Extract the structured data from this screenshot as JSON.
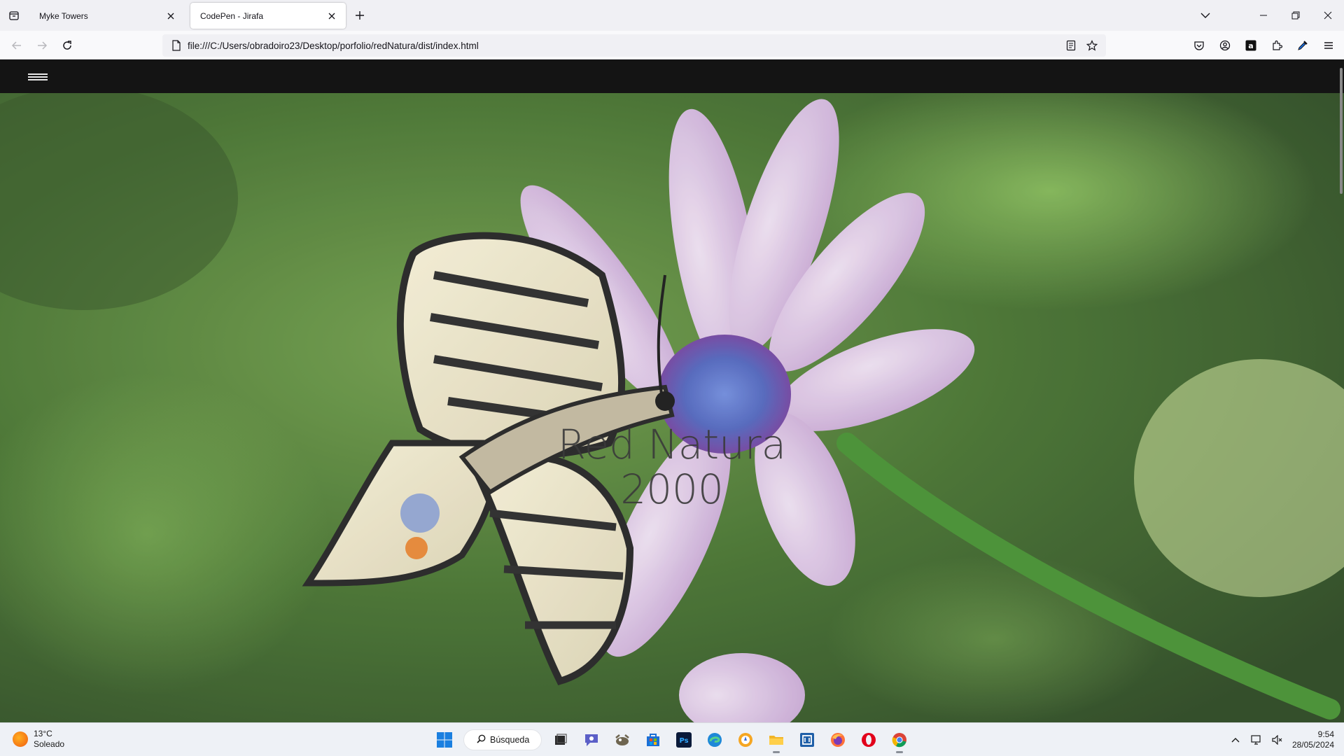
{
  "browser": {
    "tabs": [
      {
        "label": "Myke Towers",
        "active": false
      },
      {
        "label": "CodePen - Jirafa",
        "active": true
      }
    ],
    "url": "file:///C:/Users/obradoiro23/Desktop/porfolio/redNatura/dist/index.html",
    "icons": [
      "tab-list-icon",
      "close-icon",
      "new-tab-icon",
      "tab-overflow-icon",
      "minimize-icon",
      "restore-icon",
      "window-close-icon",
      "back-icon",
      "forward-icon",
      "reload-icon",
      "page-icon",
      "reader-mode-icon",
      "bookmark-star-icon",
      "pocket-icon",
      "account-icon",
      "amazon-icon",
      "extensions-icon",
      "eyedropper-icon",
      "menu-icon"
    ]
  },
  "page": {
    "header": {
      "menu_icon": "hamburger-icon"
    },
    "hero": {
      "title_line1": "Red Natura",
      "title_line2": "2000"
    }
  },
  "taskbar": {
    "weather": {
      "temperature": "13°C",
      "condition": "Soleado"
    },
    "search_label": "Búsqueda",
    "apps": [
      "windows-start-icon",
      "search-icon",
      "task-view-icon",
      "teams-chat-icon",
      "gimp-icon",
      "store-icon",
      "photoshop-icon",
      "edge-icon",
      "app-icon",
      "file-explorer-icon",
      "code-editor-icon",
      "firefox-icon",
      "opera-icon",
      "chrome-icon"
    ],
    "time": "9:54",
    "date": "28/05/2024"
  },
  "colors": {
    "header_bg": "#141414",
    "tab_strip_bg": "#f0f0f4",
    "taskbar_bg": "#eef1f6",
    "accent": "#1a73e8"
  }
}
